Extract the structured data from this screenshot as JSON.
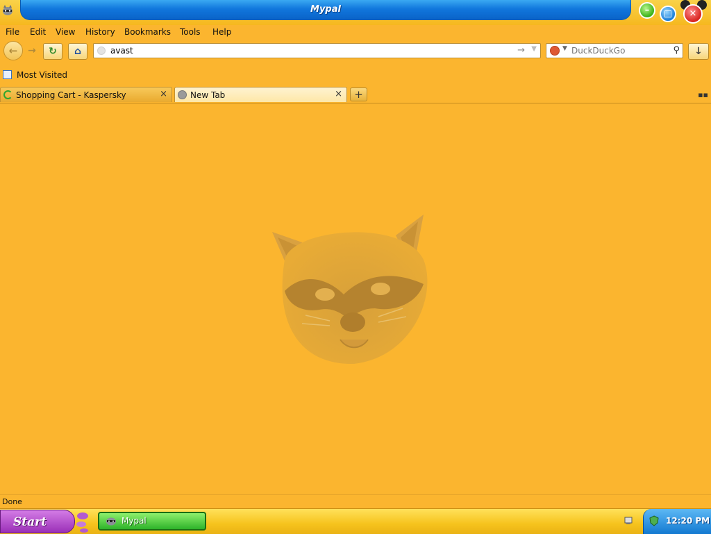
{
  "window": {
    "title": "Mypal",
    "icons": [
      "raccoon-app-icon",
      "minimize-icon",
      "maximize-icon",
      "close-icon"
    ]
  },
  "menu": {
    "items": [
      "File",
      "Edit",
      "View",
      "History",
      "Bookmarks",
      "Tools",
      "Help"
    ]
  },
  "nav": {
    "icons": [
      "back-icon",
      "forward-icon",
      "reload-icon",
      "home-icon"
    ],
    "url_value": "avast",
    "search_engine": "DuckDuckGo",
    "search_placeholder": "DuckDuckGo"
  },
  "bookmarks": {
    "most_visited": "Most Visited"
  },
  "tabs": [
    {
      "label": "Shopping Cart - Kaspersky",
      "active": false,
      "icon": "loading-spinner-icon"
    },
    {
      "label": "New Tab",
      "active": true,
      "icon": "globe-icon"
    }
  ],
  "status": {
    "text": "Done"
  },
  "taskbar": {
    "start_label": "Start",
    "task_label": "Mypal",
    "clock": "12:20 PM"
  },
  "colors": {
    "page_background": "#fbb52f",
    "title_bar_blue": "#1177dd",
    "taskbar_yellow": "#f6c31d",
    "start_purple": "#9a2fb7",
    "task_green": "#2eb32a",
    "clock_blue": "#1379d1"
  }
}
